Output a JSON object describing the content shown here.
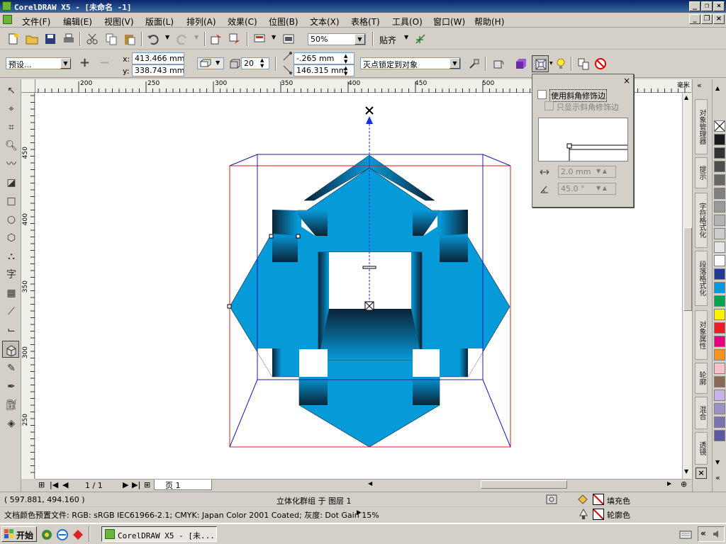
{
  "window": {
    "title": "CorelDRAW X5 - [未命名 -1]"
  },
  "menu": [
    "文件(F)",
    "编辑(E)",
    "视图(V)",
    "版面(L)",
    "排列(A)",
    "效果(C)",
    "位图(B)",
    "文本(X)",
    "表格(T)",
    "工具(O)",
    "窗口(W)",
    "帮助(H)"
  ],
  "toolbar": {
    "zoom": "50%",
    "snap_label": "贴齐"
  },
  "propbar": {
    "preset": "预设...",
    "x_label": "x:",
    "x_value": "413.466 mm",
    "y_label": "y:",
    "y_value": "338.743 mm",
    "depth": "20",
    "vp_x": "-.265 mm",
    "vp_y": "146.315 mm",
    "vanish_mode": "灭点锁定到对象"
  },
  "rulers": {
    "h_ticks": [
      "200",
      "250",
      "300",
      "350",
      "400",
      "450",
      "500"
    ],
    "h_unit": "毫米",
    "v_ticks": [
      "450",
      "400",
      "350",
      "300",
      "250"
    ]
  },
  "bevel_docker": {
    "use_bevel": "使用斜角修饰边",
    "show_bevel_only": "只显示斜角修饰边",
    "depth_value": "2.0 mm",
    "angle_value": "45.0 °"
  },
  "dock_tabs": [
    "对象管理器",
    "提示",
    "字符格式化",
    "段落格式化",
    "对象属性",
    "轮廓",
    "混合",
    "透镜"
  ],
  "palette_colors": [
    "#ffffff",
    "#1a1a1a",
    "#333333",
    "#4d4d4d",
    "#666666",
    "#808080",
    "#999999",
    "#b3b3b3",
    "#cccccc",
    "#e6e6e6",
    "#ffffff",
    "#1f3a93",
    "#009be0",
    "#00a550",
    "#fff200",
    "#ec1c24",
    "#e6007e",
    "#f7941d",
    "#f9c0c9",
    "#8b6a53",
    "#c7b3e6",
    "#9b8fc6",
    "#7b72b2",
    "#5b5aa0"
  ],
  "page_nav": {
    "page_count": "1 / 1",
    "page_tab": "页 1"
  },
  "status": {
    "coords": "( 597.881, 494.160 )",
    "selection": "立体化群组 于 图层 1",
    "fill_label": "填充色",
    "outline_label": "轮廓色",
    "color_profile": "文档颜色预置文件: RGB: sRGB IEC61966-2.1; CMYK: Japan Color 2001 Coated; 灰度: Dot Gain 15%"
  },
  "taskbar": {
    "start": "开始",
    "task": "CorelDRAW X5 - [未..."
  },
  "colors": {
    "object_fill": "#079ad9",
    "extrude_dark": "#0a2236",
    "bbox_red": "#cc2222",
    "bbox_blue": "#1a1aaa",
    "vanish_blue": "#1030e0"
  }
}
